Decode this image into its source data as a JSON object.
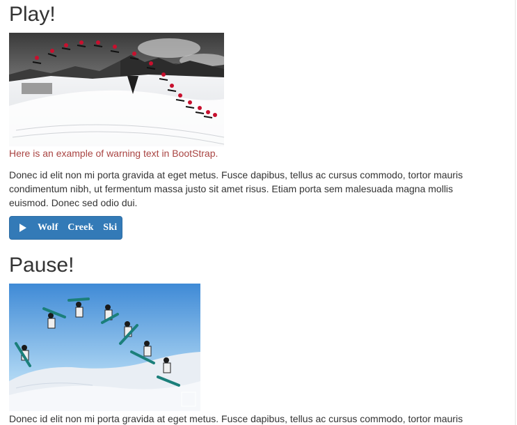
{
  "sections": {
    "play": {
      "heading": "Play!",
      "warning_text": "Here is an example of warning text in BootStrap.",
      "paragraph": "Donec id elit non mi porta gravida at eget metus. Fusce dapibus, tellus ac cursus commodo, tortor mauris condimentum nibh, ut fermentum massa justo sit amet risus. Etiam porta sem malesuada magna mollis euismod. Donec sed odio dui.",
      "button_label": "Wolf Creek Ski",
      "button_icon": "play-icon",
      "image_subject": "snowboarder-jump-sequence-grayscale"
    },
    "pause": {
      "heading": "Pause!",
      "paragraph": "Donec id elit non mi porta gravida at eget metus. Fusce dapibus, tellus ac cursus commodo, tortor mauris",
      "image_subject": "snowboarder-spin-sequence-blue-sky"
    }
  },
  "colors": {
    "warning": "#a94442",
    "button_primary": "#337ab7",
    "text": "#333333"
  }
}
